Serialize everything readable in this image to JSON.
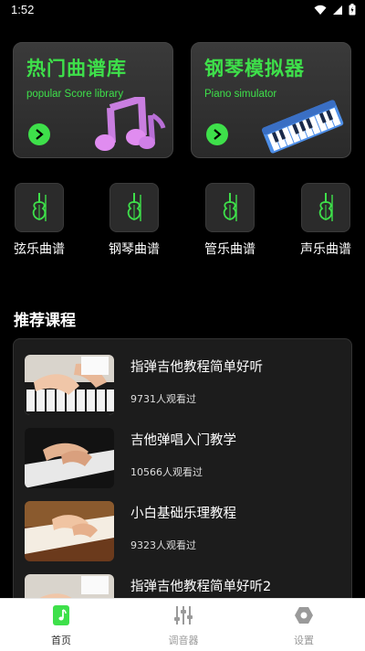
{
  "status": {
    "time": "1:52"
  },
  "banners": [
    {
      "title": "热门曲谱库",
      "subtitle": "popular Score library"
    },
    {
      "title": "钢琴模拟器",
      "subtitle": "Piano simulator"
    }
  ],
  "categories": [
    {
      "label": "弦乐曲谱",
      "icon": "violin-icon"
    },
    {
      "label": "钢琴曲谱",
      "icon": "violin-icon"
    },
    {
      "label": "管乐曲谱",
      "icon": "violin-icon"
    },
    {
      "label": "声乐曲谱",
      "icon": "violin-icon"
    }
  ],
  "recommended": {
    "title": "推荐课程",
    "courses": [
      {
        "title": "指弹吉他教程简单好听",
        "views": "9731人观看过"
      },
      {
        "title": "吉他弹唱入门教学",
        "views": "10566人观看过"
      },
      {
        "title": "小白基础乐理教程",
        "views": "9323人观看过"
      },
      {
        "title": "指弹吉他教程简单好听2",
        "views": ""
      }
    ]
  },
  "tabbar": {
    "items": [
      {
        "label": "首页",
        "icon": "home-music-icon",
        "active": true
      },
      {
        "label": "调音器",
        "icon": "tuner-sliders-icon",
        "active": false
      },
      {
        "label": "设置",
        "icon": "settings-hexagon-icon",
        "active": false
      }
    ]
  },
  "colors": {
    "accent": "#3ee04a",
    "background": "#000000",
    "card": "#2b2b2b",
    "tab_inactive": "#999999",
    "tab_active": "#333333"
  }
}
